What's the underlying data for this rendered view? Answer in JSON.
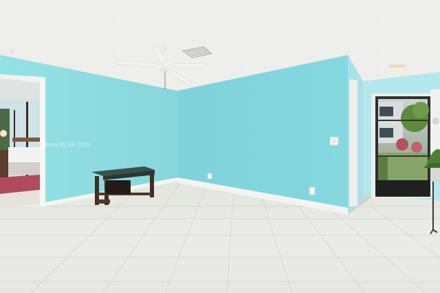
{
  "watermark": {
    "text": "Miami MLS® 2025"
  },
  "colors": {
    "ceiling": "#eeeeec",
    "wall_left": "#8ee0e4",
    "wall_center": "#82d4dc",
    "wall_right": "#aee6ec",
    "floor": "#e8e9e4",
    "grout": "#d6d8d2",
    "baseboard": "#f4f4f1",
    "furniture": "#3f2e22",
    "glass_top": "#33403b"
  }
}
